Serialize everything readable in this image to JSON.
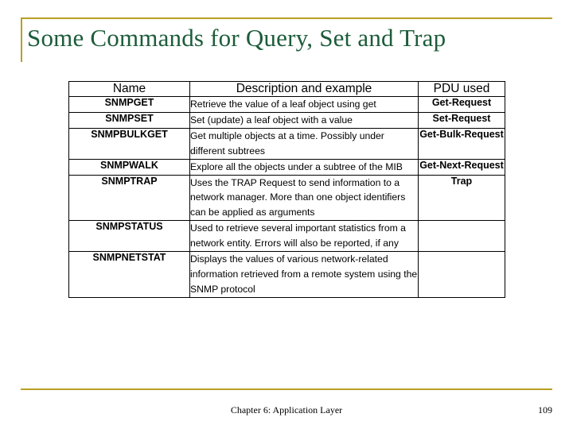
{
  "slide": {
    "title": "Some Commands for Query, Set and Trap",
    "footer_note": "Chapter 6: Application Layer",
    "page_number": "109",
    "accent_color": "#b8a024",
    "title_color": "#1c5c3a"
  },
  "table": {
    "headers": [
      "Name",
      "Description and example",
      "PDU used"
    ],
    "rows": [
      {
        "name": "SNMPGET",
        "description": "Retrieve the value of a leaf object using get",
        "pdu": "Get-Request"
      },
      {
        "name": "SNMPSET",
        "description": "Set (update) a leaf object with a value",
        "pdu": "Set-Request"
      },
      {
        "name": "SNMPBULKGET",
        "description": "Get multiple objects at a time. Possibly under different subtrees",
        "pdu": "Get-Bulk-Request"
      },
      {
        "name": "SNMPWALK",
        "description": "Explore all the objects under a subtree of the MIB",
        "pdu": "Get-Next-Request"
      },
      {
        "name": "SNMPTRAP",
        "description": "Uses the TRAP Request to send information to a network manager. More than one object identifiers can be applied as arguments",
        "pdu": "Trap"
      },
      {
        "name": "SNMPSTATUS",
        "description": "Used to retrieve several important statistics from a network entity. Errors will also be reported, if any",
        "pdu": ""
      },
      {
        "name": "SNMPNETSTAT",
        "description": "Displays the values of various network-related information retrieved from a remote system using the SNMP protocol",
        "pdu": ""
      }
    ]
  }
}
